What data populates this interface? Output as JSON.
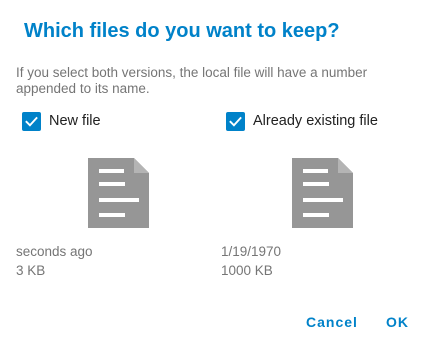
{
  "dialog": {
    "title": "Which files do you want to keep?",
    "description": "If you select both versions, the local file will have a number appended to its name.",
    "accent_color": "#0082c9",
    "new_file": {
      "label": "New file",
      "checked": true,
      "icon": "document-icon",
      "modified": "seconds ago",
      "size": "3 KB"
    },
    "existing_file": {
      "label": "Already existing file",
      "checked": true,
      "icon": "document-icon",
      "modified": "1/19/1970",
      "size": "1000 KB"
    },
    "buttons": {
      "cancel": "Cancel",
      "ok": "OK"
    }
  }
}
